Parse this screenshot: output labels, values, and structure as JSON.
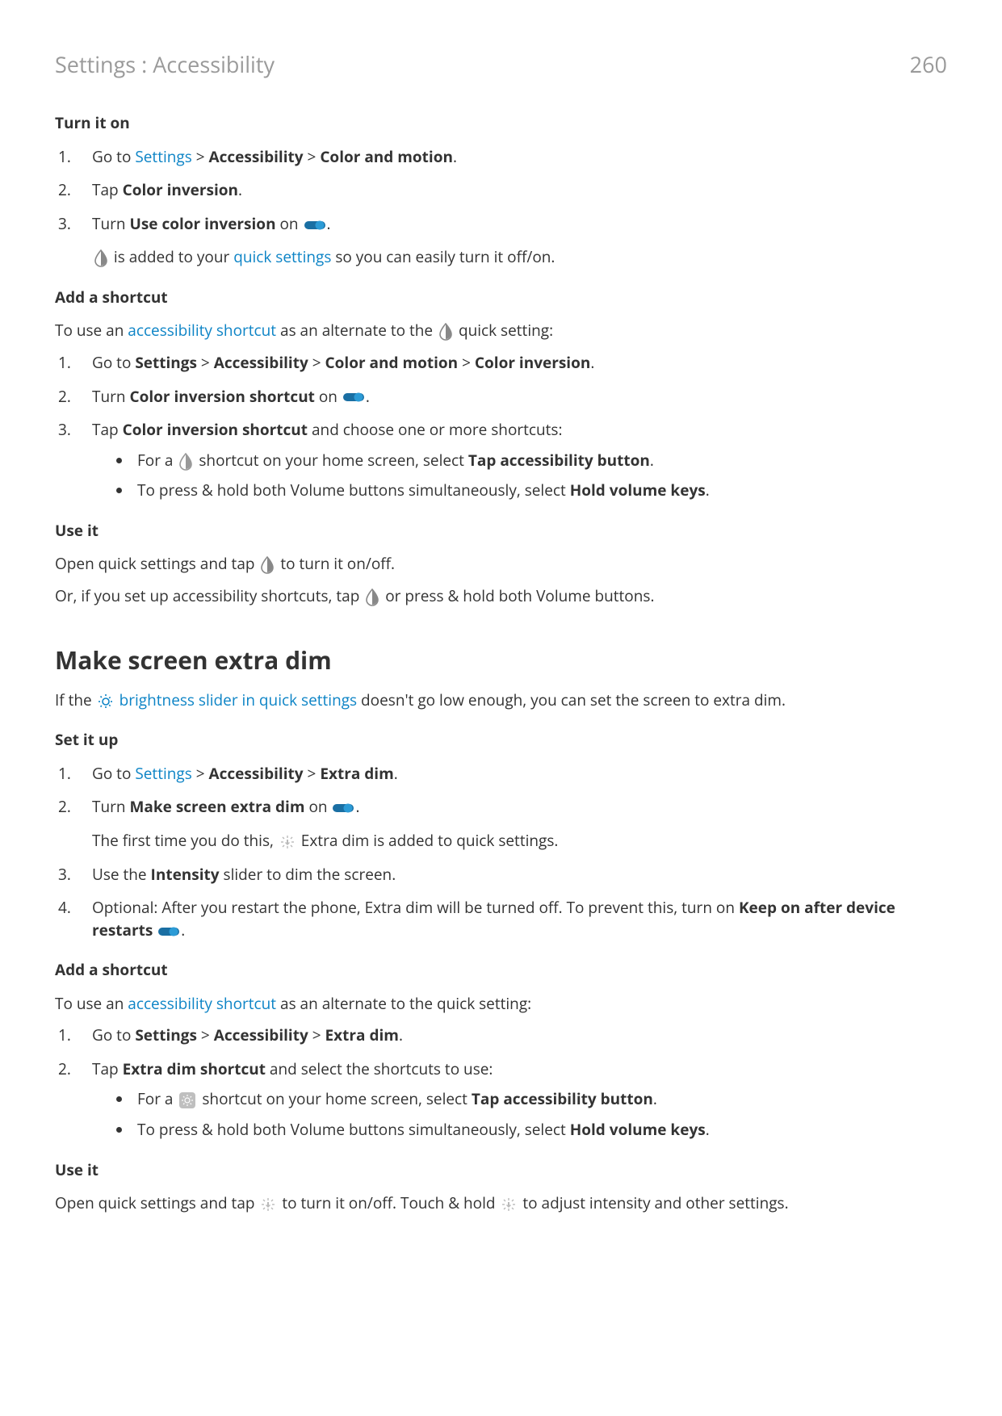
{
  "header": {
    "title": "Settings : Accessibility",
    "page": "260"
  },
  "s1": {
    "heading": "Turn it on",
    "step1_a": "Go to ",
    "step1_link": "Settings",
    "step1_b": " > ",
    "step1_c": "Accessibility",
    "step1_d": " > ",
    "step1_e": "Color and motion",
    "step1_f": ".",
    "step2_a": "Tap ",
    "step2_b": "Color inversion",
    "step2_c": ".",
    "step3_a": "Turn ",
    "step3_b": "Use color inversion",
    "step3_c": " on ",
    "step3_d": ".",
    "step3_note_a": " is added to your ",
    "step3_note_link": "quick settings",
    "step3_note_b": " so you can easily turn it off/on."
  },
  "s2": {
    "heading": "Add a shortcut",
    "intro_a": "To use an ",
    "intro_link": "accessibility shortcut",
    "intro_b": " as an alternate to the ",
    "intro_c": " quick setting:",
    "step1_a": "Go to ",
    "step1_b": "Settings",
    "step1_c": " > ",
    "step1_d": "Accessibility",
    "step1_e": " > ",
    "step1_f": "Color and motion",
    "step1_g": " > ",
    "step1_h": "Color inversion",
    "step1_i": ".",
    "step2_a": "Turn ",
    "step2_b": "Color inversion shortcut",
    "step2_c": " on ",
    "step2_d": ".",
    "step3_a": "Tap ",
    "step3_b": "Color inversion shortcut",
    "step3_c": " and choose one or more shortcuts:",
    "b1_a": "For a ",
    "b1_b": " shortcut on your home screen, select ",
    "b1_c": "Tap accessibility button",
    "b1_d": ".",
    "b2_a": "To press & hold both Volume buttons simultaneously, select ",
    "b2_b": "Hold volume keys",
    "b2_c": "."
  },
  "s3": {
    "heading": "Use it",
    "p1_a": "Open quick settings and tap ",
    "p1_b": " to turn it on/off.",
    "p2_a": "Or, if you set up accessibility shortcuts, tap ",
    "p2_b": " or press & hold both Volume buttons."
  },
  "s4": {
    "heading": "Make screen extra dim",
    "intro_a": "If the ",
    "intro_link": "brightness slider in quick settings",
    "intro_b": " doesn't go low enough, you can set the screen to extra dim."
  },
  "s5": {
    "heading": "Set it up",
    "step1_a": "Go to ",
    "step1_link": "Settings",
    "step1_b": " > ",
    "step1_c": "Accessibility",
    "step1_d": " > ",
    "step1_e": "Extra dim",
    "step1_f": ".",
    "step2_a": "Turn ",
    "step2_b": "Make screen extra dim",
    "step2_c": " on ",
    "step2_d": ".",
    "step2_note_a": "The first time you do this, ",
    "step2_note_b": " Extra dim is added to quick settings.",
    "step3_a": "Use the ",
    "step3_b": "Intensity",
    "step3_c": " slider to dim the screen.",
    "step4_a": "Optional: After you restart the phone, Extra dim will be turned off. To prevent this, turn on ",
    "step4_b": "Keep on after device restarts",
    "step4_c": " ",
    "step4_d": "."
  },
  "s6": {
    "heading": "Add a shortcut",
    "intro_a": "To use an ",
    "intro_link": "accessibility shortcut",
    "intro_b": " as an alternate to the quick setting:",
    "step1_a": "Go to ",
    "step1_b": "Settings",
    "step1_c": " > ",
    "step1_d": "Accessibility",
    "step1_e": " > ",
    "step1_f": "Extra dim",
    "step1_g": ".",
    "step2_a": "Tap ",
    "step2_b": "Extra dim shortcut",
    "step2_c": " and select the shortcuts to use:",
    "b1_a": "For a ",
    "b1_b": " shortcut on your home screen, select ",
    "b1_c": "Tap accessibility button",
    "b1_d": ".",
    "b2_a": "To press & hold both Volume buttons simultaneously, select ",
    "b2_b": "Hold volume keys",
    "b2_c": "."
  },
  "s7": {
    "heading": "Use it",
    "p1_a": "Open quick settings and tap ",
    "p1_b": " to turn it on/off. Touch & hold ",
    "p1_c": " to adjust intensity and other settings."
  }
}
